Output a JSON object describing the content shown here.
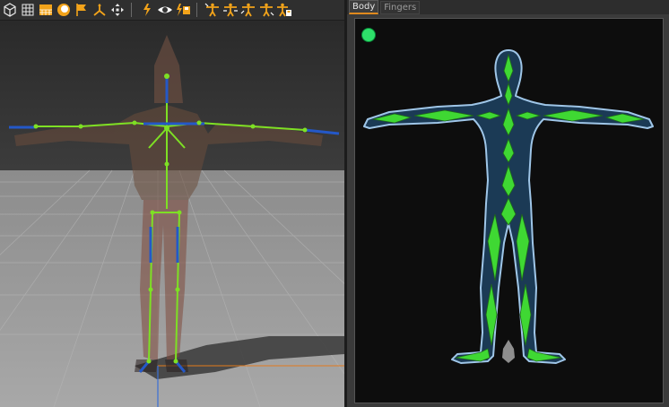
{
  "toolbar": {
    "buttons": [
      {
        "name": "perspective-cube-icon"
      },
      {
        "name": "grid-icon"
      },
      {
        "name": "floor-icon"
      },
      {
        "name": "shading-sphere-icon"
      },
      {
        "name": "flag-icon"
      },
      {
        "name": "axis-gizmo-icon"
      },
      {
        "name": "move-arrows-icon"
      },
      {
        "name": "pose-key-icon"
      },
      {
        "name": "eye-icon"
      },
      {
        "name": "save-pose-icon"
      },
      {
        "name": "tpose-select-icon"
      },
      {
        "name": "tpose-mirror-icon"
      },
      {
        "name": "tpose-copy-icon"
      },
      {
        "name": "tpose-paste-icon"
      },
      {
        "name": "tpose-save-icon"
      }
    ],
    "accent": "#f2a31a"
  },
  "panel": {
    "tabs": [
      {
        "label": "Body",
        "active": true
      },
      {
        "label": "Fingers",
        "active": false
      }
    ],
    "status_color": "#2ee06a",
    "bone_color": "#3fd833",
    "body_color": "#1b3a55",
    "outline_color": "#9fc6e8"
  }
}
